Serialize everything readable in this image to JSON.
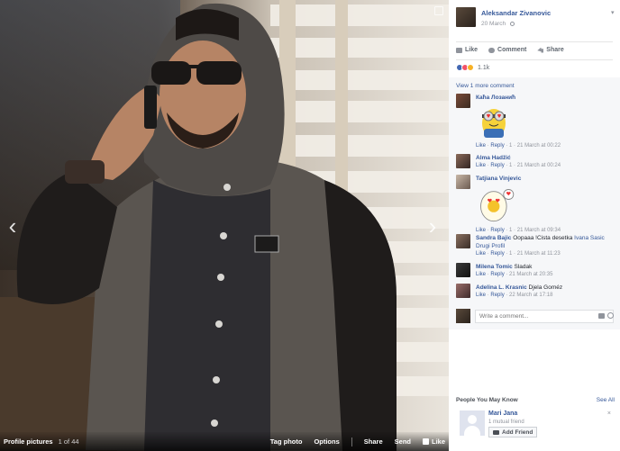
{
  "photo_viewer": {
    "album_label": "Profile pictures",
    "position": "1 of 44",
    "actions": [
      "Tag photo",
      "Options",
      "Share",
      "Send",
      "Like"
    ],
    "prev_icon": "chevron-left-icon",
    "next_icon": "chevron-right-icon"
  },
  "post": {
    "author": "Aleksandar Zivanovic",
    "date": "20 March",
    "privacy_icon": "globe-icon",
    "actions": {
      "like": "Like",
      "comment": "Comment",
      "share": "Share"
    },
    "reaction_count": "1.1k"
  },
  "comments": {
    "view_more": "View 1 more comment",
    "items": [
      {
        "name": "Каћа Лозанић",
        "text": "",
        "sticker": "minion-love",
        "like": "Like",
        "reply": "Reply",
        "likes": "1",
        "time": "21 March at 00:22"
      },
      {
        "name": "Alma Hadžić",
        "text": "",
        "sticker": "",
        "like": "Like",
        "reply": "Reply",
        "likes": "1",
        "time": "21 March at 00:24"
      },
      {
        "name": "Tatjiana Vinjevic",
        "text": "",
        "sticker": "egg-love",
        "like": "Like",
        "reply": "Reply",
        "likes": "1",
        "time": "21 March at 09:34"
      },
      {
        "name": "Sandra Bajic",
        "text": "Oopaaa",
        "text2": "!Cista desetka",
        "tag1": "Ivana",
        "tag2": "Sasic Drugi Profil",
        "like": "Like",
        "reply": "Reply",
        "likes": "1",
        "time": "21 March at 11:23"
      },
      {
        "name": "Milena Tomic",
        "text": "Sladak",
        "like": "Like",
        "reply": "Reply",
        "likes": "",
        "time": "21 March at 20:35"
      },
      {
        "name": "Adelina L. Krasnic",
        "text": "Djela Goméz",
        "like": "Like",
        "reply": "Reply",
        "likes": "",
        "time": "22 March at 17:18"
      }
    ],
    "write_placeholder": "Write a comment..."
  },
  "pymk": {
    "header": "People You May Know",
    "see_all": "See All",
    "person": {
      "name": "Mari Jana",
      "mutual": "1 mutual friend",
      "add_label": "Add Friend"
    }
  },
  "colors": {
    "link": "#365899",
    "meta": "#90949c",
    "like_blue": "#4267b2"
  }
}
